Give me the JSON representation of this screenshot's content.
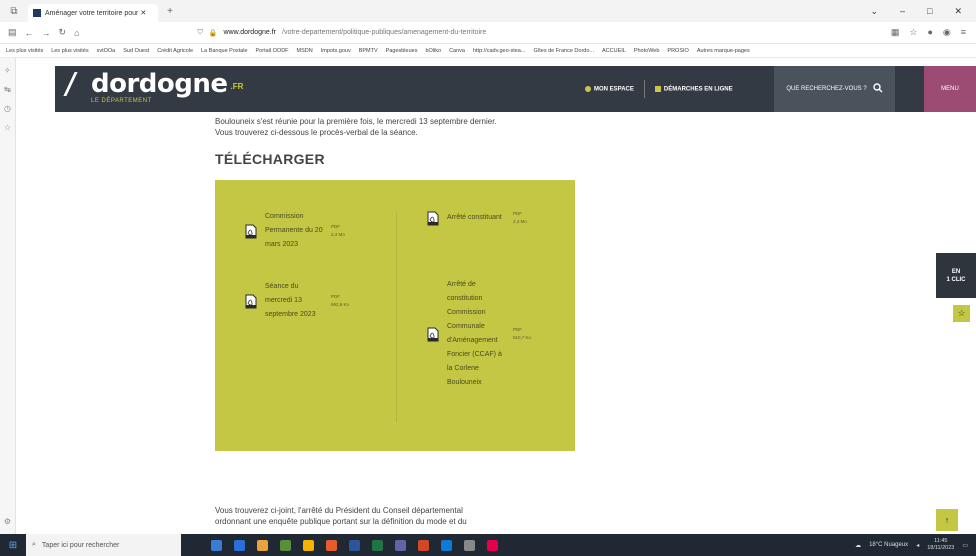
{
  "browser": {
    "tab_title": "Aménager votre territoire pour ✕",
    "url_domain": "www.dordogne.fr",
    "url_path": "/votre-departement/politique-publiques/amenagement-du-territoire",
    "bookmarks": [
      "Les plus visités",
      "Les plus visités",
      "svtOOa",
      "Sud Ouest",
      "Crédit Agricole",
      "La Banque Postale",
      "Portail OODF",
      "MSDN",
      "Impots.gouv",
      "BPMTV",
      "Pagesbleues",
      "bOliko",
      "Canva",
      "http://cadv.geo-stea...",
      "Gîtes de France Dordo...",
      "ACCUEIL",
      "PhotoWeb",
      "PROSIO",
      "Autres marque-pages"
    ]
  },
  "header": {
    "logo_word": "dordogne",
    "logo_fr": ".FR",
    "logo_sub": "LE DÉPARTEMENT",
    "nav_espace": "MON ESPACE",
    "nav_demarches": "DÉMARCHES EN LIGNE",
    "search_label": "QUE RECHERCHEZ-VOUS ?",
    "menu_label": "MENU"
  },
  "content": {
    "intro_line1": "Boulouneix s'est réunie pour la première fois, le mercredi 13 septembre dernier.",
    "intro_line2": "Vous trouverez ci-dessous le procès-verbal de la séance.",
    "download_title": "TÉLÉCHARGER",
    "downloads": [
      {
        "name": "Commission Permanente du 20 mars 2023",
        "type": "PDF",
        "size": "2,4 Mo"
      },
      {
        "name": "Séance du mercredi 13 septembre 2023",
        "type": "PDF",
        "size": "992,8 Ko"
      },
      {
        "name": "Arrêté constituant",
        "type": "PDF",
        "size": "2,4 Mo"
      },
      {
        "name": "Arrêté de constitution Commission Communale d'Aménagement Foncier (CCAF) à la Corlene Boulouneix",
        "type": "PDF",
        "size": "510,7 Ko"
      }
    ],
    "bottom_line1": "Vous trouverez ci-joint, l'arrêté du Président du Conseil départemental",
    "bottom_line2": "ordonnant une enquête publique portant sur la définition du mode et du"
  },
  "floating": {
    "en1clic_line1": "EN",
    "en1clic_line2": "1 CLIC"
  },
  "taskbar": {
    "search_placeholder": "Taper ici pour rechercher",
    "weather": "18°C Nuageux",
    "time": "11:45",
    "date": "18/11/2023"
  },
  "colors": {
    "accent_green": "#c4c744",
    "header_dark": "#333a43",
    "menu_purple": "#9c4c73"
  }
}
